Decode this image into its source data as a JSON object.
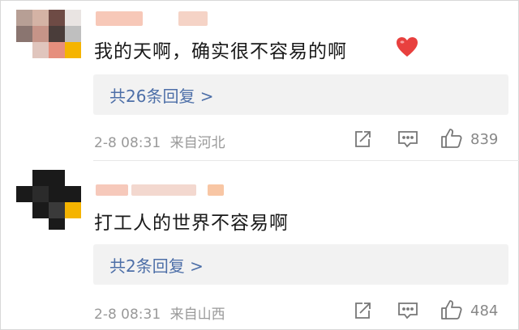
{
  "comments": [
    {
      "text": "我的天啊，确实很不容易的啊",
      "replies_label": "共26条回复 >",
      "date": "2-8 08:31",
      "location": "来自河北",
      "likes": "839",
      "icons": [
        "share-icon",
        "comment-icon",
        "like-icon"
      ],
      "emoji": "heart-emoji",
      "accent": "#e8403e"
    },
    {
      "text": "打工人的世界不容易啊",
      "replies_label": "共2条回复 >",
      "date": "2-8 08:31",
      "location": "来自山西",
      "likes": "484",
      "icons": [
        "share-icon",
        "comment-icon",
        "like-icon"
      ]
    }
  ],
  "colors": {
    "link": "#4d6fa8",
    "meta": "#999999",
    "reply_bg": "#f2f2f2"
  }
}
